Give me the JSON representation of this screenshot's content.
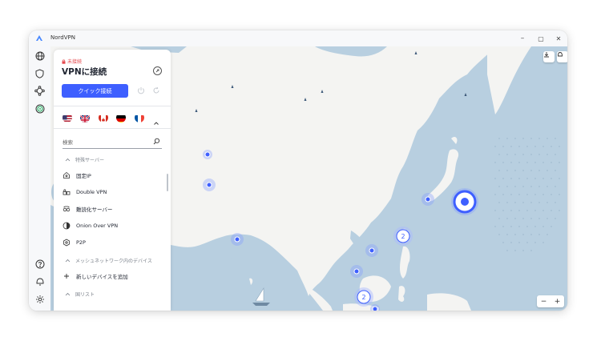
{
  "titlebar": {
    "app_name": "NordVPN",
    "minimize": "–",
    "maximize": "▢",
    "close": "✕"
  },
  "sidebar_rail": {
    "icons": [
      "globe-icon",
      "shield-icon",
      "meshnet-icon",
      "threat-protection-icon",
      "help-icon",
      "notifications-icon",
      "settings-icon"
    ]
  },
  "panel": {
    "status": "未接続",
    "headline": "VPNに接続",
    "quick_connect": "クイック接続",
    "favorite_flags": [
      "United States",
      "United Kingdom",
      "Canada",
      "Germany",
      "France"
    ],
    "search_placeholder": "検索",
    "section_specialty": "特殊サーバー",
    "items": [
      {
        "label": "固定IP",
        "icon": "dedicated-ip-icon"
      },
      {
        "label": "Double VPN",
        "icon": "double-vpn-icon"
      },
      {
        "label": "難読化サーバー",
        "icon": "obfuscated-icon"
      },
      {
        "label": "Onion Over VPN",
        "icon": "onion-icon"
      },
      {
        "label": "P2P",
        "icon": "p2p-icon"
      }
    ],
    "section_meshnet": "メッシュネットワーク内のデバイス",
    "add_device": "新しいデバイスを追加",
    "section_countries": "国リスト"
  },
  "map": {
    "clusters": [
      "2",
      "2"
    ],
    "zoom_out": "−",
    "zoom_in": "+"
  },
  "colors": {
    "accent": "#3e5fff",
    "land": "#f4f4f2",
    "water": "#b8cfe0",
    "status_red": "#e5484d"
  }
}
